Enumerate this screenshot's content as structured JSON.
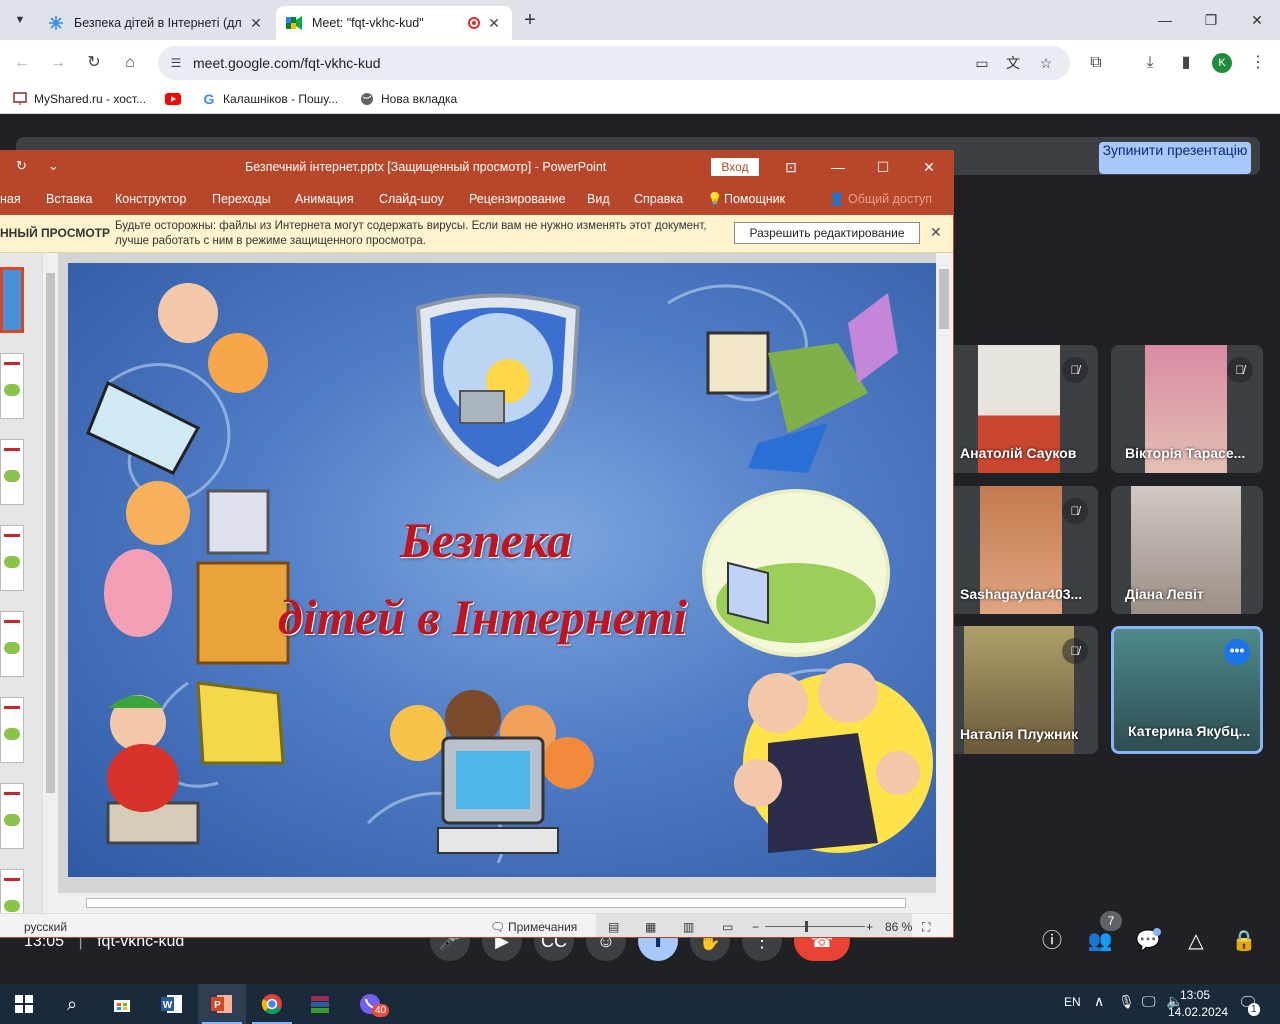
{
  "browser": {
    "tabs": [
      {
        "title": "Безпека дітей в Інтернеті (для",
        "active": false
      },
      {
        "title": "Meet: \"fqt-vkhc-kud\"",
        "active": true
      }
    ],
    "url": "meet.google.com/fqt-vkhc-kud",
    "profile_initial": "K",
    "bookmarks": [
      "MyShared.ru - хост...",
      "",
      "Калашніков - Пошу...",
      "Нова вкладка"
    ]
  },
  "meet": {
    "stop_presenting": "Зупинити презентацію",
    "time": "13:05",
    "meeting_code": "fqt-vkhc-kud",
    "people_count": "7",
    "participants": [
      {
        "name": "Анатолій Сауков",
        "muted": true
      },
      {
        "name": "Вікторія Тарасе...",
        "muted": true
      },
      {
        "name": "Sashagaydar403...",
        "muted": true
      },
      {
        "name": "Діана Левіт",
        "muted": false
      },
      {
        "name": "Наталія Плужник",
        "muted": true
      },
      {
        "name": "Катерина Якубц...",
        "muted": false,
        "speaking": true
      }
    ]
  },
  "ppt": {
    "window_title": "Безпечний інтернет.pptx [Защищенный просмотр]  -  PowerPoint",
    "login": "Вход",
    "ribbon": [
      "ная",
      "Вставка",
      "Конструктор",
      "Переходы",
      "Анимация",
      "Слайд-шоу",
      "Рецензирование",
      "Вид",
      "Справка",
      "Помощник",
      "Общий доступ"
    ],
    "protected_label": "ННЫЙ ПРОСМОТР",
    "protected_message": "Будьте осторожны: файлы из Интернета могут содержать вирусы. Если вам не нужно изменять этот документ, лучше работать с ним в режиме защищенного просмотра.",
    "enable_editing": "Разрешить редактирование",
    "slide_title_line1": "Безпека",
    "slide_title_line2": "дітей в Інтернеті",
    "language": "русский",
    "notes": "Примечания",
    "zoom": "86 %"
  },
  "taskbar": {
    "lang": "EN",
    "time": "13:05",
    "date": "14.02.2024",
    "viber_badge": "40",
    "notif_badge": "1"
  }
}
